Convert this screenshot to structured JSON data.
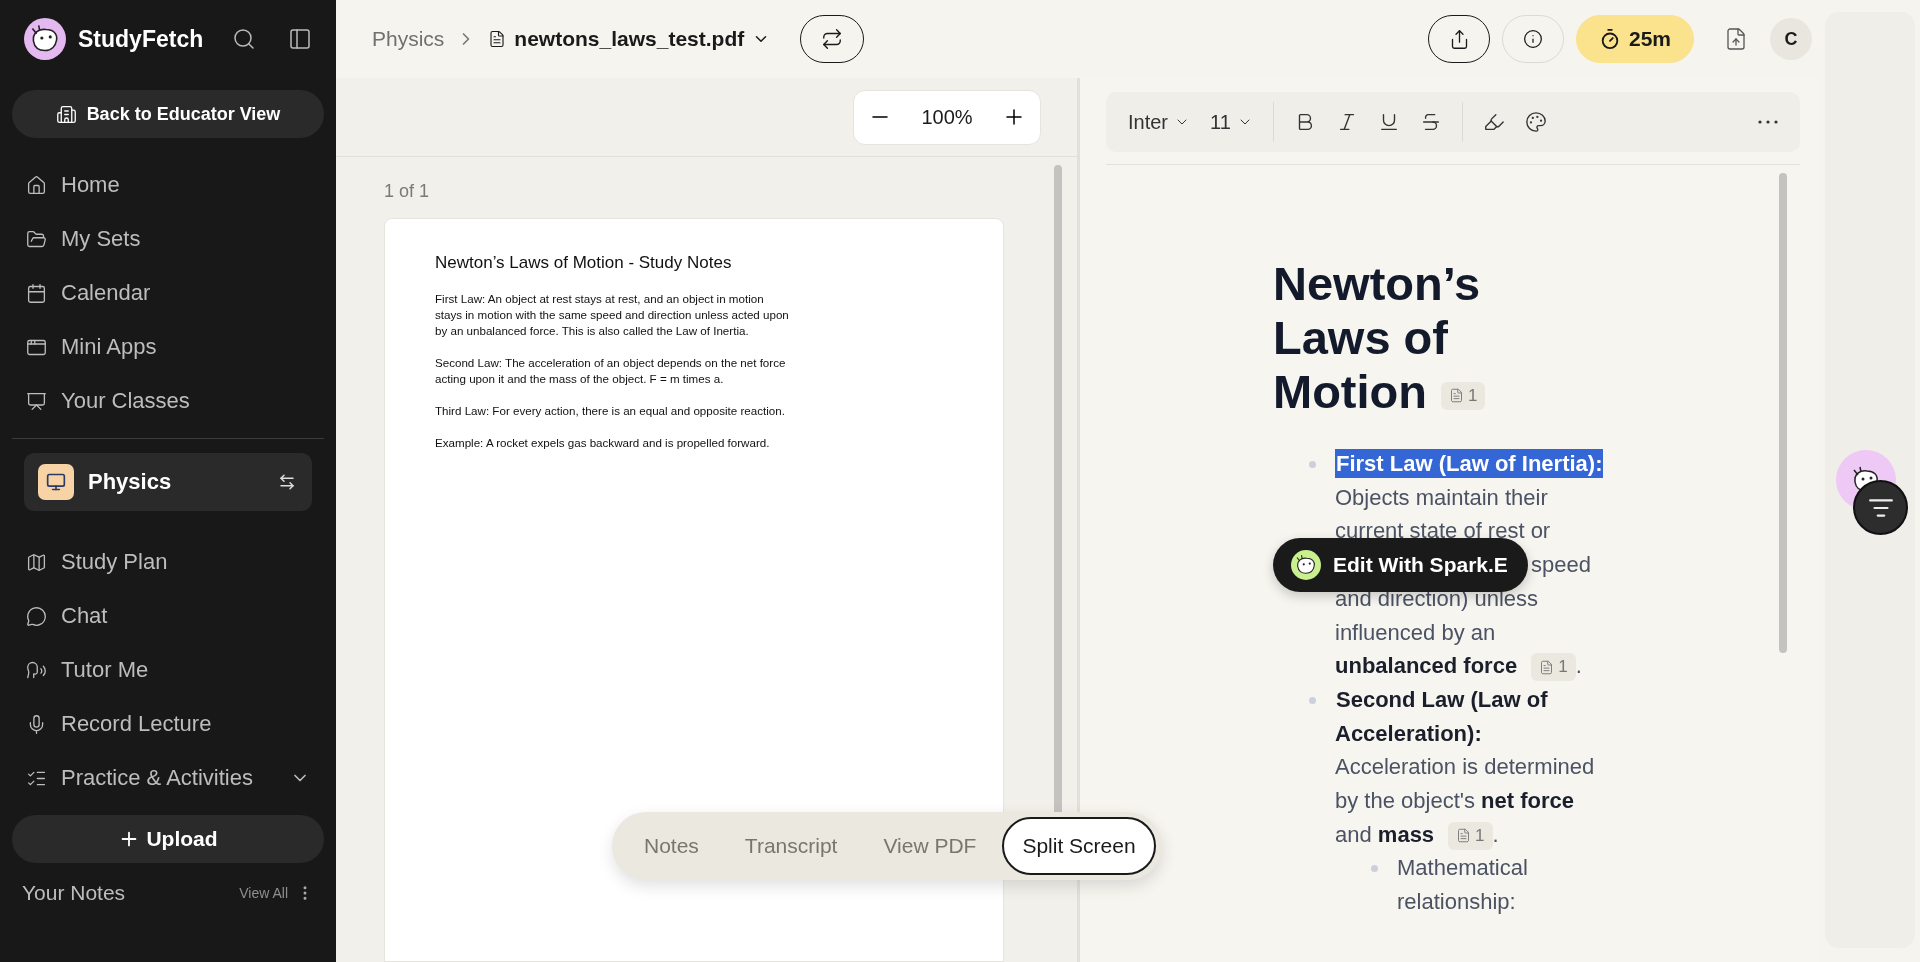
{
  "sidebar": {
    "brand": "StudyFetch",
    "back_button": "Back to Educator View",
    "nav_top": [
      {
        "label": "Home"
      },
      {
        "label": "My Sets"
      },
      {
        "label": "Calendar"
      },
      {
        "label": "Mini Apps"
      },
      {
        "label": "Your Classes"
      }
    ],
    "class_card": {
      "name": "Physics"
    },
    "nav_class": [
      {
        "label": "Study Plan"
      },
      {
        "label": "Chat"
      },
      {
        "label": "Tutor Me"
      },
      {
        "label": "Record Lecture"
      }
    ],
    "practice_group": {
      "label": "Practice & Activities",
      "expanded": false
    },
    "upload_button": "Upload",
    "notes_section": {
      "title": "Your Notes",
      "view_all": "View All"
    }
  },
  "header": {
    "breadcrumb": {
      "parent": "Physics",
      "file": "newtons_laws_test.pdf"
    },
    "timer": "25m",
    "avatar": "C"
  },
  "pdf_viewer": {
    "zoom": "100%",
    "page_indicator": "1 of 1",
    "document": {
      "title": "Newton’s Laws of Motion - Study Notes",
      "paragraphs": [
        "First Law: An object at rest stays at rest, and an object in motion stays in motion with the same speed and direction unless acted upon by an unbalanced force. This is also called the Law of Inertia.",
        "Second Law: The acceleration of an object depends on the net force acting upon it and the mass of the object. F = m times a.",
        "Third Law: For every action, there is an equal and opposite reaction.",
        "Example: A rocket expels gas backward and is propelled forward."
      ]
    }
  },
  "view_tabs": [
    {
      "label": "Notes",
      "selected": false
    },
    {
      "label": "Transcript",
      "selected": false
    },
    {
      "label": "View PDF",
      "selected": false
    },
    {
      "label": "Split Screen",
      "selected": true
    }
  ],
  "editor": {
    "toolbar": {
      "font": "Inter",
      "size": "11"
    },
    "spark_button": "Edit With Spark.E",
    "notes": {
      "title": "Newton’s Laws of Motion",
      "title_citation": "1",
      "items": [
        {
          "heading": "First Law (Law of Inertia):",
          "highlighted": true,
          "body": "Objects maintain their current state of rest or",
          "beside_button": "speed",
          "body_continued": "and direction) unless influenced by an **unbalanced force**",
          "citation": "1",
          "suffix": "."
        },
        {
          "heading": "Second Law (Law of Acceleration):",
          "highlighted": false,
          "body": "Acceleration is determined by the object's **net force** and **mass**",
          "citation": "1",
          "suffix": ".",
          "children": [
            {
              "body": "Mathematical relationship:"
            }
          ]
        }
      ]
    }
  }
}
